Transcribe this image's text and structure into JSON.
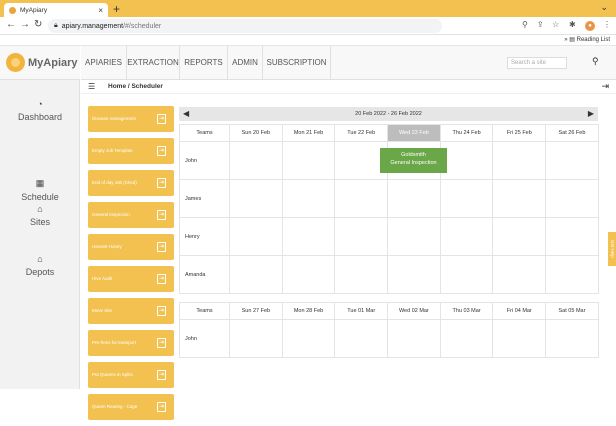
{
  "browser": {
    "tab_title": "MyApiary",
    "tab_close": "×",
    "new_tab": "+",
    "url_domain": "apiary.management",
    "url_path": "/#/scheduler",
    "reading_list": "Reading List"
  },
  "logo": {
    "text": "MyApiary"
  },
  "sidebar": {
    "items": [
      {
        "label": "Dashboard"
      },
      {
        "label": "Schedule"
      },
      {
        "label": "Sites"
      },
      {
        "label": "Depots"
      }
    ]
  },
  "topnav": {
    "items": [
      "APIARIES",
      "EXTRACTION",
      "REPORTS",
      "ADMIN",
      "SUBSCRIPTION"
    ],
    "search_placeholder": "Search a site"
  },
  "breadcrumb": "Home / Scheduler",
  "jobs": [
    "Disease management",
    "Empty Job Template",
    "End of day Job (Shed)",
    "General Inspection",
    "Harvest Honey",
    "Hive Audit",
    "Move Site",
    "Pre-frees for transport",
    "Put Queens in Splits",
    "Queen Rearing - Cage"
  ],
  "scheduler": {
    "week_label": "20 Feb 2022 - 26 Feb 2022",
    "week1": {
      "header": [
        "Teams",
        "Sun 20 Feb",
        "Mon 21 Feb",
        "Tue 22 Feb",
        "Wed 23 Feb",
        "Thu 24 Feb",
        "Fri 25 Feb",
        "Sat 26 Feb"
      ],
      "rows": [
        "John",
        "James",
        "Henry",
        "Amanda"
      ]
    },
    "week2": {
      "header": [
        "Teams",
        "Sun 27 Feb",
        "Mon 28 Feb",
        "Tue 01 Mar",
        "Wed 02 Mar",
        "Thu 03 Mar",
        "Fri 04 Mar",
        "Sat 05 Mar"
      ],
      "rows": [
        "John"
      ]
    },
    "event": {
      "line1": "Goldsmith",
      "line2": "General Inspection"
    }
  },
  "help_tab": "Get Help"
}
